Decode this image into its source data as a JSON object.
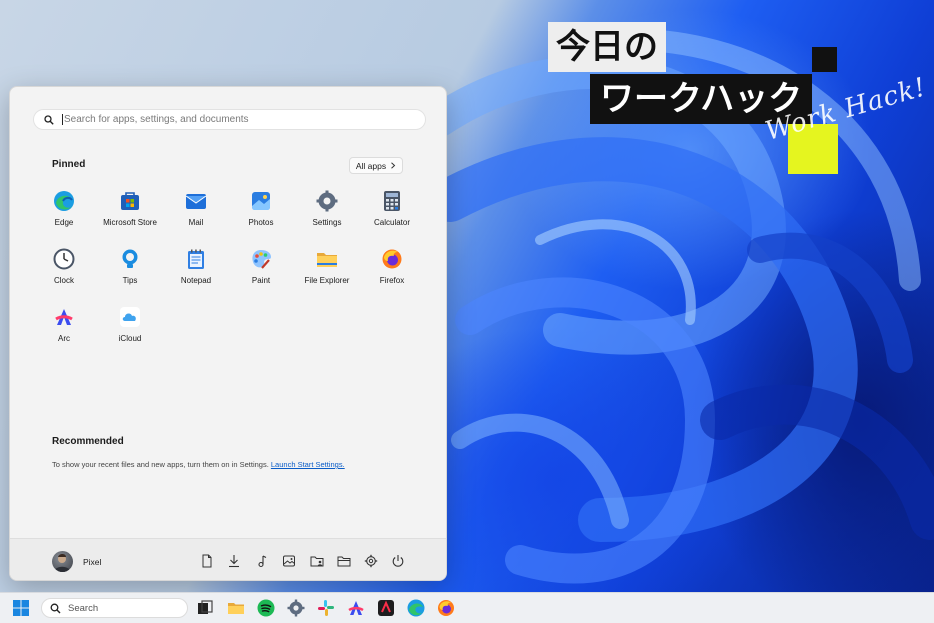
{
  "banner": {
    "line1": "今日の",
    "line2": "ワークハック",
    "script": "Work Hack!"
  },
  "start_menu": {
    "search": {
      "placeholder": "Search for apps, settings, and documents"
    },
    "pinned": {
      "title": "Pinned",
      "all_apps_label": "All apps",
      "apps": [
        {
          "label": "Edge",
          "icon": "edge-icon"
        },
        {
          "label": "Microsoft Store",
          "icon": "microsoft-store-icon"
        },
        {
          "label": "Mail",
          "icon": "mail-icon"
        },
        {
          "label": "Photos",
          "icon": "photos-icon"
        },
        {
          "label": "Settings",
          "icon": "settings-icon"
        },
        {
          "label": "Calculator",
          "icon": "calculator-icon"
        },
        {
          "label": "Clock",
          "icon": "clock-icon"
        },
        {
          "label": "Tips",
          "icon": "tips-icon"
        },
        {
          "label": "Notepad",
          "icon": "notepad-icon"
        },
        {
          "label": "Paint",
          "icon": "paint-icon"
        },
        {
          "label": "File Explorer",
          "icon": "file-explorer-icon"
        },
        {
          "label": "Firefox",
          "icon": "firefox-icon"
        },
        {
          "label": "Arc",
          "icon": "arc-icon"
        },
        {
          "label": "iCloud",
          "icon": "icloud-icon"
        }
      ]
    },
    "recommended": {
      "title": "Recommended",
      "text": "To show your recent files and new apps, turn them on in Settings.",
      "link": "Launch Start Settings."
    },
    "footer": {
      "user_name": "Pixel",
      "icons": [
        "documents-icon",
        "downloads-icon",
        "music-icon",
        "pictures-icon",
        "personal-folder-icon",
        "file-explorer-icon",
        "settings-icon",
        "power-icon"
      ]
    }
  },
  "taskbar": {
    "search_label": "Search",
    "icons": [
      "start-icon",
      "task-view-icon",
      "file-explorer-icon",
      "spotify-icon",
      "settings-icon",
      "slack-icon",
      "arc-icon",
      "app-icon",
      "edge-icon",
      "firefox-icon"
    ]
  },
  "colors": {
    "accent": "#0a5cc7",
    "wallpaper_blue": "#1e5ef2",
    "banner_lime": "#e5f51f"
  }
}
